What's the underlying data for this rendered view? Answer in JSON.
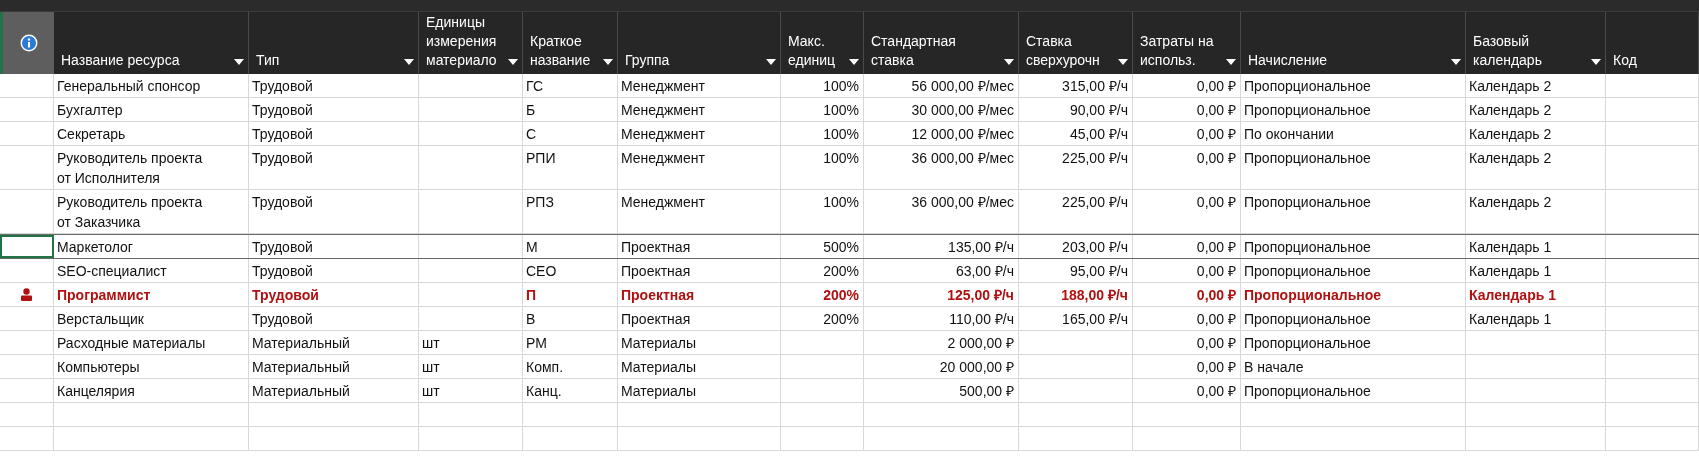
{
  "table": {
    "columns": [
      {
        "label": "Название ресурса",
        "kind": "text",
        "filter": true
      },
      {
        "label": "Тип",
        "kind": "text",
        "filter": true
      },
      {
        "label": "Единицы\nизмерения\nматериало",
        "kind": "text",
        "filter": true
      },
      {
        "label": "Краткое\nназвание",
        "kind": "text",
        "filter": true
      },
      {
        "label": "Группа",
        "kind": "text",
        "filter": true
      },
      {
        "label": "Макс.\nединиц",
        "kind": "number",
        "filter": true
      },
      {
        "label": "Стандартная\nставка",
        "kind": "number",
        "filter": true
      },
      {
        "label": "Ставка\nсверхурочн",
        "kind": "number",
        "filter": true
      },
      {
        "label": "Затраты на\nиспольз.",
        "kind": "number",
        "filter": true
      },
      {
        "label": "Начисление",
        "kind": "text",
        "filter": true
      },
      {
        "label": "Базовый\nкалендарь",
        "kind": "text",
        "filter": true
      },
      {
        "label": "Код",
        "kind": "text",
        "filter": false
      }
    ],
    "rows": [
      {
        "selected": false,
        "overallocated": false,
        "cells": [
          "Генеральный спонсор",
          "Трудовой",
          "",
          "ГС",
          "Менеджмент",
          "100%",
          "56 000,00 ₽/мес",
          "315,00 ₽/ч",
          "0,00 ₽",
          "Пропорциональное",
          "Календарь 2",
          ""
        ]
      },
      {
        "selected": false,
        "overallocated": false,
        "cells": [
          "Бухгалтер",
          "Трудовой",
          "",
          "Б",
          "Менеджмент",
          "100%",
          "30 000,00 ₽/мес",
          "90,00 ₽/ч",
          "0,00 ₽",
          "Пропорциональное",
          "Календарь 2",
          ""
        ]
      },
      {
        "selected": false,
        "overallocated": false,
        "cells": [
          "Секретарь",
          "Трудовой",
          "",
          "С",
          "Менеджмент",
          "100%",
          "12 000,00 ₽/мес",
          "45,00 ₽/ч",
          "0,00 ₽",
          "По окончании",
          "Календарь 2",
          ""
        ]
      },
      {
        "selected": false,
        "overallocated": false,
        "cells": [
          "Руководитель проекта\nот Исполнителя",
          "Трудовой",
          "",
          "РПИ",
          "Менеджмент",
          "100%",
          "36 000,00 ₽/мес",
          "225,00 ₽/ч",
          "0,00 ₽",
          "Пропорциональное",
          "Календарь 2",
          ""
        ]
      },
      {
        "selected": false,
        "overallocated": false,
        "cells": [
          "Руководитель проекта\nот Заказчика",
          "Трудовой",
          "",
          "РПЗ",
          "Менеджмент",
          "100%",
          "36 000,00 ₽/мес",
          "225,00 ₽/ч",
          "0,00 ₽",
          "Пропорциональное",
          "Календарь 2",
          ""
        ]
      },
      {
        "selected": true,
        "overallocated": false,
        "cells": [
          "Маркетолог",
          "Трудовой",
          "",
          "М",
          "Проектная",
          "500%",
          "135,00 ₽/ч",
          "203,00 ₽/ч",
          "0,00 ₽",
          "Пропорциональное",
          "Календарь 1",
          ""
        ]
      },
      {
        "selected": false,
        "overallocated": false,
        "cells": [
          "SEO-специалист",
          "Трудовой",
          "",
          "СЕО",
          "Проектная",
          "200%",
          "63,00 ₽/ч",
          "95,00 ₽/ч",
          "0,00 ₽",
          "Пропорциональное",
          "Календарь 1",
          ""
        ]
      },
      {
        "selected": false,
        "overallocated": true,
        "cells": [
          "Программист",
          "Трудовой",
          "",
          "П",
          "Проектная",
          "200%",
          "125,00 ₽/ч",
          "188,00 ₽/ч",
          "0,00 ₽",
          "Пропорциональное",
          "Календарь 1",
          ""
        ]
      },
      {
        "selected": false,
        "overallocated": false,
        "cells": [
          "Верстальщик",
          "Трудовой",
          "",
          "В",
          "Проектная",
          "200%",
          "110,00 ₽/ч",
          "165,00 ₽/ч",
          "0,00 ₽",
          "Пропорциональное",
          "Календарь 1",
          ""
        ]
      },
      {
        "selected": false,
        "overallocated": false,
        "cells": [
          "Расходные материалы",
          "Материальный",
          "шт",
          "РМ",
          "Материалы",
          "",
          "2 000,00 ₽",
          "",
          "0,00 ₽",
          "Пропорциональное",
          "",
          ""
        ]
      },
      {
        "selected": false,
        "overallocated": false,
        "cells": [
          "Компьютеры",
          "Материальный",
          "шт",
          "Комп.",
          "Материалы",
          "",
          "20 000,00 ₽",
          "",
          "0,00 ₽",
          "В начале",
          "",
          ""
        ]
      },
      {
        "selected": false,
        "overallocated": false,
        "cells": [
          "Канцелярия",
          "Материальный",
          "шт",
          "Канц.",
          "Материалы",
          "",
          "500,00 ₽",
          "",
          "0,00 ₽",
          "Пропорциональное",
          "",
          ""
        ]
      }
    ]
  }
}
